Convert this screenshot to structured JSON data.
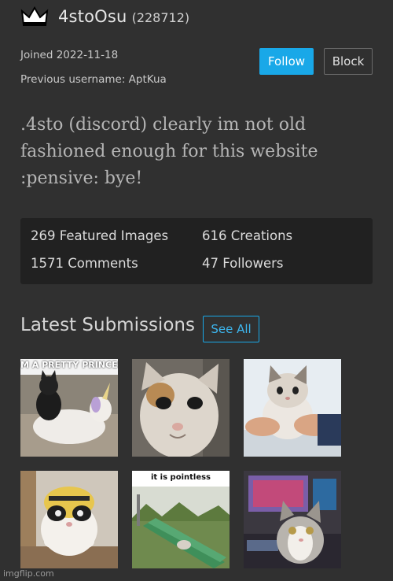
{
  "profile": {
    "username": "4stoOsu",
    "user_id": "(228712)",
    "joined": "Joined 2022-11-18",
    "previous_username": "Previous username: AptKua",
    "bio": ".4sto (discord) clearly im not old fashioned enough for this website :pensive: bye!"
  },
  "actions": {
    "follow_label": "Follow",
    "block_label": "Block"
  },
  "stats": {
    "featured": "269 Featured Images",
    "creations": "616 Creations",
    "comments": "1571 Comments",
    "followers": "47 Followers"
  },
  "latest": {
    "title": "Latest Submissions",
    "see_all_label": "See All",
    "thumbnails": [
      {
        "caption": "M A PRETTY PRINCESS :",
        "icon": "cat-on-unicorn-image"
      },
      {
        "caption": "",
        "icon": "cat-closeup-image"
      },
      {
        "caption": "",
        "icon": "kitten-in-hands-image"
      },
      {
        "caption": "",
        "icon": "cat-in-bee-hat-image"
      },
      {
        "caption": "it is pointless",
        "icon": "cat-on-slide-image"
      },
      {
        "caption": "",
        "icon": "cat-at-desk-image"
      }
    ]
  },
  "watermark": "imgflip.com",
  "colors": {
    "background": "#303030",
    "stats_panel": "#212121",
    "accent": "#19a8e8"
  }
}
